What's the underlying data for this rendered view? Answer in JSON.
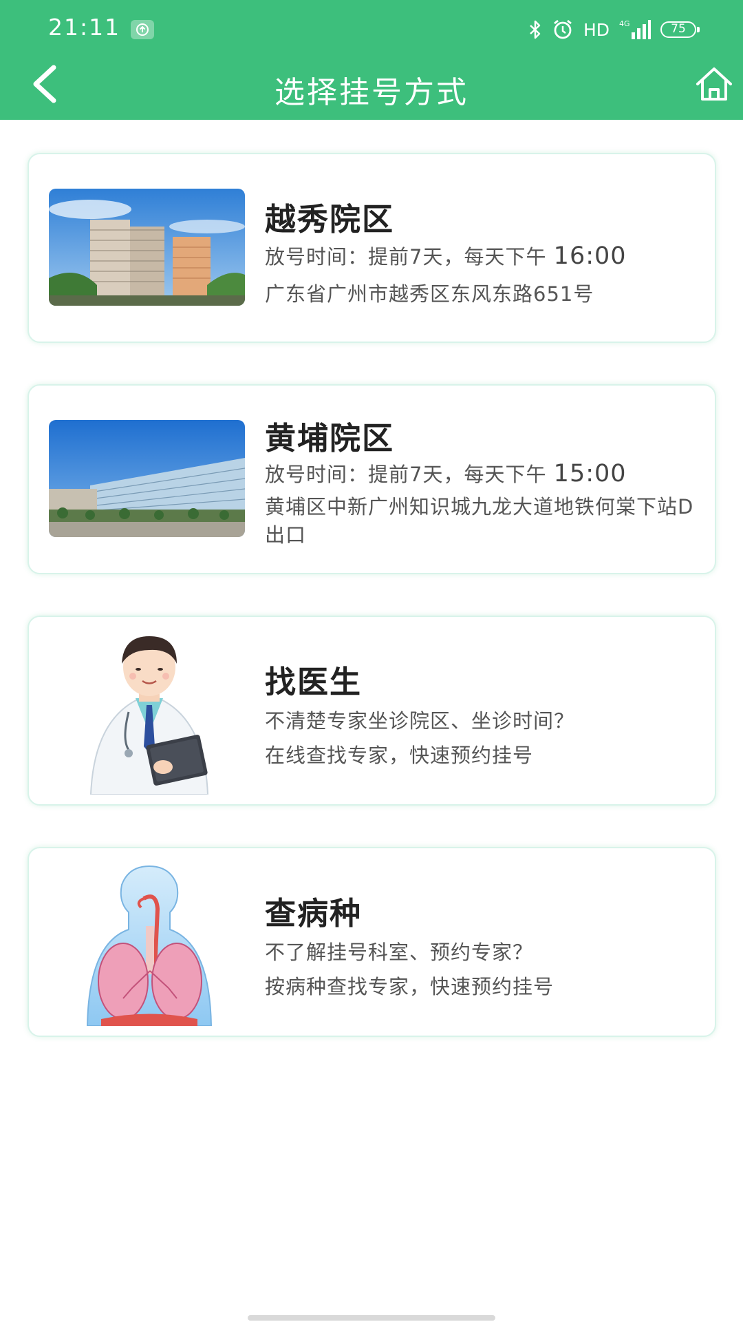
{
  "status": {
    "time": "21:11",
    "network": "HD",
    "signal": "4G",
    "battery": "75"
  },
  "nav": {
    "title": "选择挂号方式",
    "back_icon": "chevron-left-icon",
    "home_icon": "home-icon"
  },
  "cards": [
    {
      "title": "越秀院区",
      "line1_prefix": "放号时间：提前7天，每天下午 ",
      "line1_time": "16:00",
      "line2": "广东省广州市越秀区东风东路651号",
      "image": "hospital-building-photo"
    },
    {
      "title": "黄埔院区",
      "line1_prefix": "放号时间：提前7天，每天下午 ",
      "line1_time": "15:00",
      "line2": "黄埔区中新广州知识城九龙大道地铁何棠下站D出口",
      "image": "hospital-campus-photo"
    },
    {
      "title": "找医生",
      "line1": "不清楚专家坐诊院区、坐诊时间？",
      "line2": "在线查找专家，快速预约挂号",
      "image": "doctor-illustration"
    },
    {
      "title": "查病种",
      "line1": "不了解挂号科室、预约专家？",
      "line2": "按病种查找专家，快速预约挂号",
      "image": "lungs-illustration"
    }
  ],
  "colors": {
    "header": "#3dbf7c",
    "card_border": "#d8f3ea"
  }
}
